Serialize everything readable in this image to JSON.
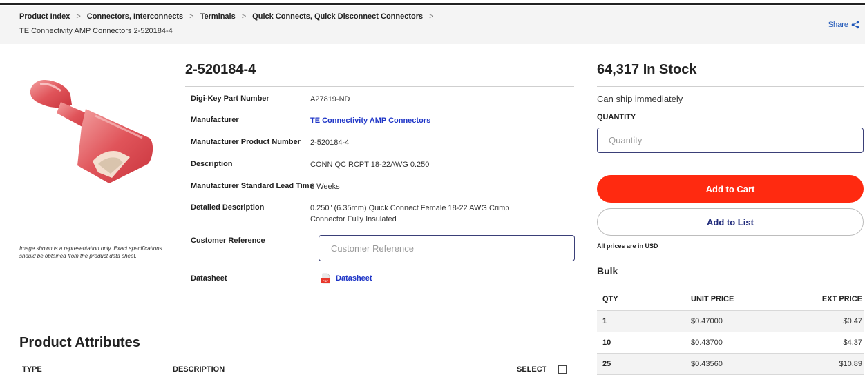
{
  "breadcrumb": {
    "items": [
      "Product Index",
      "Connectors, Interconnects",
      "Terminals",
      "Quick Connects, Quick Disconnect Connectors"
    ],
    "separator": ">",
    "current": "TE Connectivity AMP Connectors 2-520184-4"
  },
  "share": {
    "label": "Share",
    "icon": "share-icon"
  },
  "image": {
    "alt": "red insulated quick connect female terminal",
    "note": "Image shown is a representation only. Exact specifications should be obtained from the product data sheet."
  },
  "product": {
    "title": "2-520184-4",
    "details": [
      {
        "label": "Digi-Key Part Number",
        "value": "A27819-ND"
      },
      {
        "label": "Manufacturer",
        "value": "TE Connectivity AMP Connectors"
      },
      {
        "label": "Manufacturer Product Number",
        "value": "2-520184-4"
      },
      {
        "label": "Description",
        "value": "CONN QC RCPT 18-22AWG 0.250"
      },
      {
        "label": "Manufacturer Standard Lead Time",
        "value": "8 Weeks"
      },
      {
        "label": "Detailed Description",
        "value": "0.250\" (6.35mm) Quick Connect Female 18-22 AWG Crimp Connector Fully Insulated"
      },
      {
        "label": "Customer Reference",
        "placeholder": "Customer Reference"
      },
      {
        "label": "Datasheet",
        "value": "Datasheet"
      }
    ]
  },
  "attributes": {
    "title": "Product Attributes",
    "columns": [
      "TYPE",
      "DESCRIPTION",
      "SELECT"
    ]
  },
  "purchase": {
    "stock": "64,317 In Stock",
    "ship_text": "Can ship immediately",
    "quantity_label": "QUANTITY",
    "quantity_placeholder": "Quantity",
    "add_to_cart": "Add to Cart",
    "add_to_list": "Add to List",
    "currency_note": "All prices are in USD",
    "packaging": "Bulk",
    "price_columns": [
      "QTY",
      "UNIT PRICE",
      "EXT PRICE"
    ],
    "price_rows": [
      {
        "qty": "1",
        "unit": "$0.47000",
        "ext": "$0.47"
      },
      {
        "qty": "10",
        "unit": "$0.43700",
        "ext": "$4.37"
      },
      {
        "qty": "25",
        "unit": "$0.43560",
        "ext": "$10.89"
      }
    ]
  },
  "colors": {
    "accent_red": "#ff2a10",
    "link_blue": "#1f36c7",
    "input_border": "#3a3f78"
  }
}
